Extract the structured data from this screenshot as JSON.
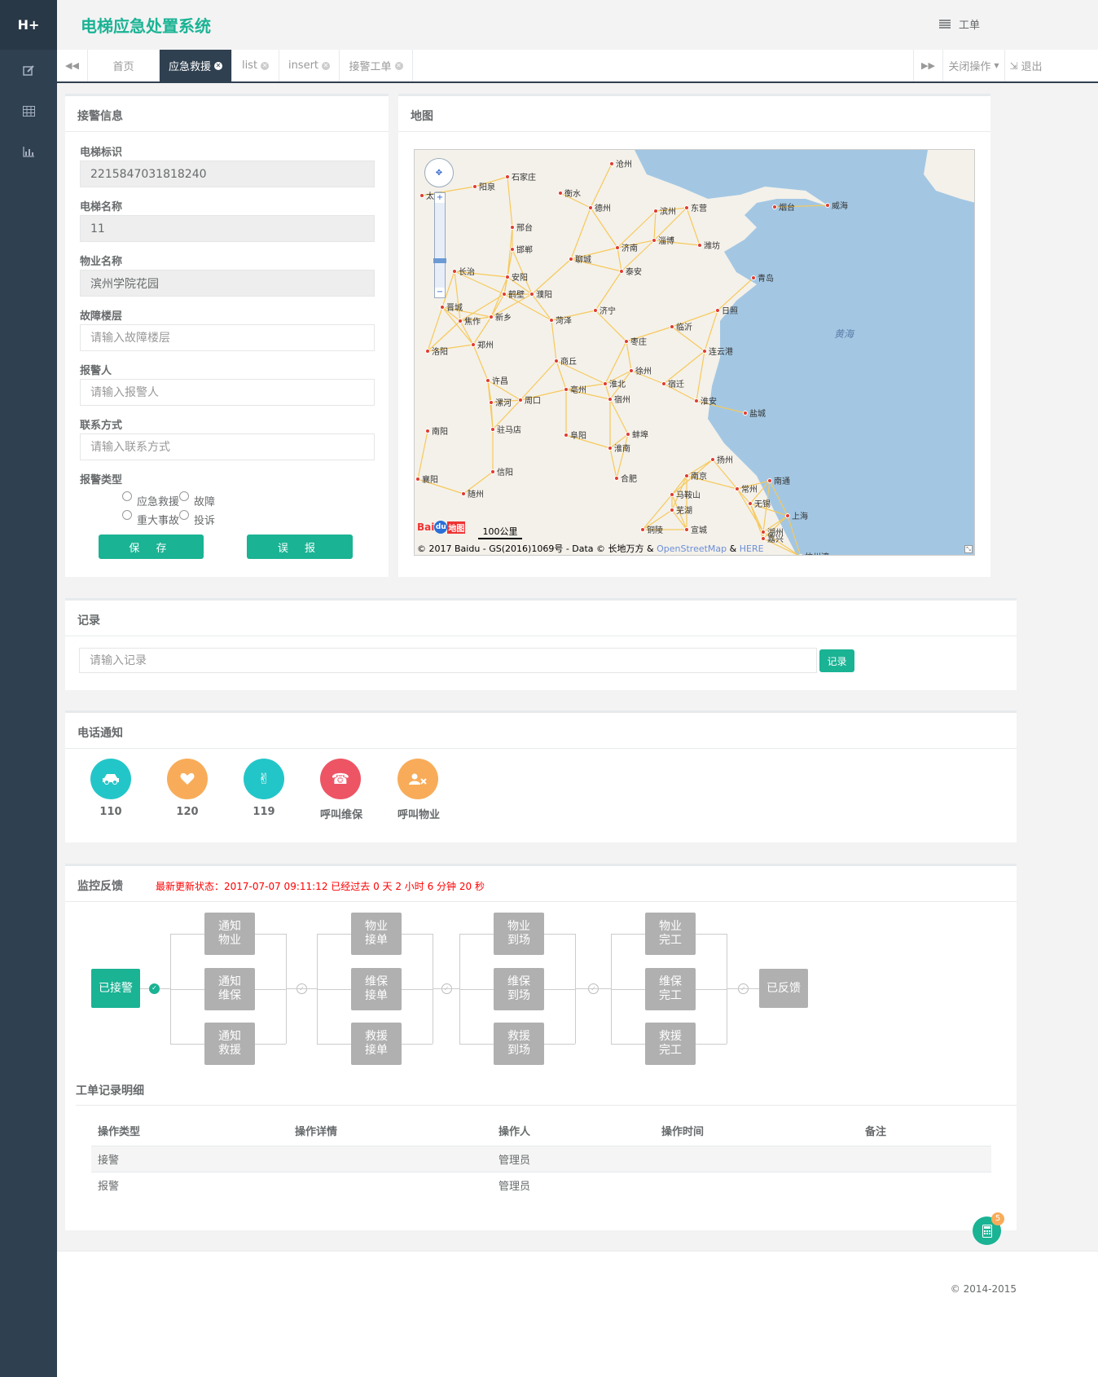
{
  "logo": "H+",
  "app_title": "电梯应急处置系统",
  "header_right": "工单",
  "tabs": [
    {
      "label": "首页",
      "closable": false,
      "active": false
    },
    {
      "label": "应急救援",
      "closable": true,
      "active": true
    },
    {
      "label": "list",
      "closable": true,
      "active": false
    },
    {
      "label": "insert",
      "closable": true,
      "active": false
    },
    {
      "label": "接警工单",
      "closable": true,
      "active": false
    }
  ],
  "tab_close_ops": "关闭操作",
  "tab_logout": "退出",
  "alarm": {
    "title": "接警信息",
    "fields": [
      {
        "label": "电梯标识",
        "value": "2215847031818240",
        "placeholder": ""
      },
      {
        "label": "电梯名称",
        "value": "11",
        "placeholder": ""
      },
      {
        "label": "物业名称",
        "value": "滨州学院花园",
        "placeholder": ""
      },
      {
        "label": "故障楼层",
        "value": "",
        "placeholder": "请输入故障楼层"
      },
      {
        "label": "报警人",
        "value": "",
        "placeholder": "请输入报警人"
      },
      {
        "label": "联系方式",
        "value": "",
        "placeholder": "请输入联系方式"
      }
    ],
    "type_label": "报警类型",
    "types": [
      "应急救援",
      "故障",
      "重大事故",
      "投诉"
    ],
    "save": "保 存",
    "false_alarm": "误 报"
  },
  "map": {
    "title": "地图",
    "sea_label": "黄海",
    "scale": "100公里",
    "copyright": "© 2017 Baidu - GS(2016)1069号 - Data © 长地万方 & ",
    "osm": "OpenStreetMap",
    "amp": " & ",
    "here": "HERE",
    "baidu_logo": "Bai",
    "baidu_logo2": "地图",
    "cities": [
      "沧州",
      "石家庄",
      "衡水",
      "阳泉",
      "太原",
      "德州",
      "滨州",
      "东营",
      "烟台",
      "威海",
      "邢台",
      "济南",
      "淄博",
      "潍坊",
      "邯郸",
      "聊城",
      "长治",
      "安阳",
      "泰安",
      "青岛",
      "鹤壁",
      "濮阳",
      "晋城",
      "新乡",
      "焦作",
      "济宁",
      "菏泽",
      "日照",
      "郑州",
      "洛阳",
      "临沂",
      "枣庄",
      "连云港",
      "商丘",
      "徐州",
      "许昌",
      "淮北",
      "宿迁",
      "亳州",
      "漯河",
      "周口",
      "宿州",
      "淮安",
      "盐城",
      "驻马店",
      "阜阳",
      "蚌埠",
      "南阳",
      "淮南",
      "扬州",
      "信阳",
      "合肥",
      "南京",
      "南通",
      "襄阳",
      "随州",
      "马鞍山",
      "常州",
      "无锡",
      "芜湖",
      "上海",
      "铜陵",
      "宣城",
      "湖州",
      "嘉兴",
      "杭州湾"
    ]
  },
  "record": {
    "title": "记录",
    "placeholder": "请输入记录",
    "button": "记录"
  },
  "phone": {
    "title": "电话通知",
    "items": [
      {
        "label": "110",
        "icon": "car-icon",
        "color": "#23c6c8"
      },
      {
        "label": "120",
        "icon": "heart-icon",
        "color": "#f8ac59"
      },
      {
        "label": "119",
        "icon": "fire-icon",
        "color": "#23c6c8"
      },
      {
        "label": "呼叫维保",
        "icon": "phone-icon",
        "color": "#ed5565"
      },
      {
        "label": "呼叫物业",
        "icon": "user-x-icon",
        "color": "#f8ac59"
      }
    ]
  },
  "monitor": {
    "title": "监控反馈",
    "status": "最新更新状态：2017-07-07 09:11:12 已经过去 0 天 2 小时 6 分钟 20 秒",
    "start": "已接警",
    "end": "已反馈",
    "columns": [
      [
        "通知物业",
        "通知维保",
        "通知救援"
      ],
      [
        "物业接单",
        "维保接单",
        "救援接单"
      ],
      [
        "物业到场",
        "维保到场",
        "救援到场"
      ],
      [
        "物业完工",
        "维保完工",
        "救援完工"
      ]
    ]
  },
  "orders": {
    "title": "工单记录明细",
    "headers": [
      "操作类型",
      "操作详情",
      "操作人",
      "操作时间",
      "备注"
    ],
    "rows": [
      [
        "接警",
        "",
        "管理员",
        "",
        ""
      ],
      [
        "报警",
        "",
        "管理员",
        "",
        ""
      ]
    ]
  },
  "fab_badge": "5",
  "footer": "© 2014-2015"
}
